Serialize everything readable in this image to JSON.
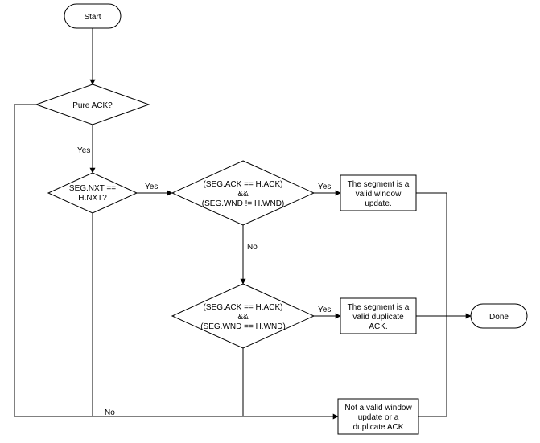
{
  "flowchart": {
    "start": "Start",
    "done": "Done",
    "dec_pure_ack": "Pure ACK?",
    "dec_segnxt_l1": "SEG.NXT ==",
    "dec_segnxt_l2": "H.NXT?",
    "dec_ackwnd_ne_l1": "(SEG.ACK == H.ACK)",
    "dec_ackwnd_ne_l2": "&&",
    "dec_ackwnd_ne_l3": "(SEG.WND != H.WND)",
    "dec_ackwnd_eq_l1": "(SEG.ACK == H.ACK)",
    "dec_ackwnd_eq_l2": "&&",
    "dec_ackwnd_eq_l3": "(SEG.WND == H.WND)",
    "out_winupd_l1": "The segment is a",
    "out_winupd_l2": "valid window",
    "out_winupd_l3": "update.",
    "out_dupack_l1": "The segment is a",
    "out_dupack_l2": "valid duplicate",
    "out_dupack_l3": "ACK.",
    "out_none_l1": "Not a valid window",
    "out_none_l2": "update or a",
    "out_none_l3": "duplicate ACK",
    "lbl_yes": "Yes",
    "lbl_no": "No"
  },
  "chart_data": {
    "type": "flowchart",
    "nodes": [
      {
        "id": "start",
        "kind": "terminator",
        "label": "Start"
      },
      {
        "id": "pure_ack",
        "kind": "decision",
        "label": "Pure ACK?"
      },
      {
        "id": "segnxt",
        "kind": "decision",
        "label": "SEG.NXT == H.NXT?"
      },
      {
        "id": "ack_wnd_ne",
        "kind": "decision",
        "label": "(SEG.ACK == H.ACK) && (SEG.WND != H.WND)"
      },
      {
        "id": "ack_wnd_eq",
        "kind": "decision",
        "label": "(SEG.ACK == H.ACK) && (SEG.WND == H.WND)"
      },
      {
        "id": "win_update",
        "kind": "process",
        "label": "The segment is a valid window update."
      },
      {
        "id": "dup_ack",
        "kind": "process",
        "label": "The segment is a valid duplicate ACK."
      },
      {
        "id": "not_valid",
        "kind": "process",
        "label": "Not a valid window update or a duplicate ACK"
      },
      {
        "id": "done",
        "kind": "terminator",
        "label": "Done"
      }
    ],
    "edges": [
      {
        "from": "start",
        "to": "pure_ack"
      },
      {
        "from": "pure_ack",
        "to": "segnxt",
        "label": "Yes"
      },
      {
        "from": "pure_ack",
        "to": "not_valid",
        "label": "No"
      },
      {
        "from": "segnxt",
        "to": "ack_wnd_ne",
        "label": "Yes"
      },
      {
        "from": "segnxt",
        "to": "not_valid",
        "label": "No"
      },
      {
        "from": "ack_wnd_ne",
        "to": "win_update",
        "label": "Yes"
      },
      {
        "from": "ack_wnd_ne",
        "to": "ack_wnd_eq",
        "label": "No"
      },
      {
        "from": "ack_wnd_eq",
        "to": "dup_ack",
        "label": "Yes"
      },
      {
        "from": "ack_wnd_eq",
        "to": "not_valid",
        "label": "No"
      },
      {
        "from": "win_update",
        "to": "done"
      },
      {
        "from": "dup_ack",
        "to": "done"
      },
      {
        "from": "not_valid",
        "to": "done"
      }
    ]
  }
}
